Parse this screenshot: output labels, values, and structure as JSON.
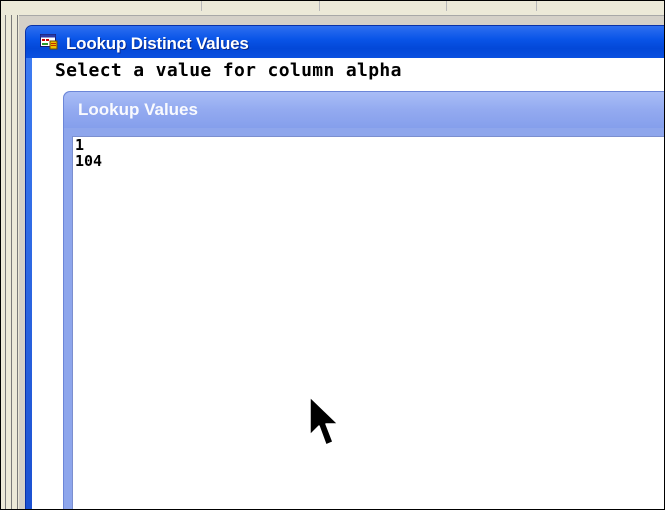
{
  "main_window": {
    "title": "Lookup Distinct Values",
    "prompt": "Select a value for column alpha"
  },
  "lookup_window": {
    "title": "Lookup Values",
    "values": [
      "1",
      "104"
    ]
  },
  "icons": {
    "app_icon": "application-window-icon",
    "cursor": "mouse-pointer-arrow"
  },
  "colors": {
    "titlebar_active": "#0a55e8",
    "titlebar_inactive": "#93aaf0",
    "window_border": "#1a4fd0"
  }
}
